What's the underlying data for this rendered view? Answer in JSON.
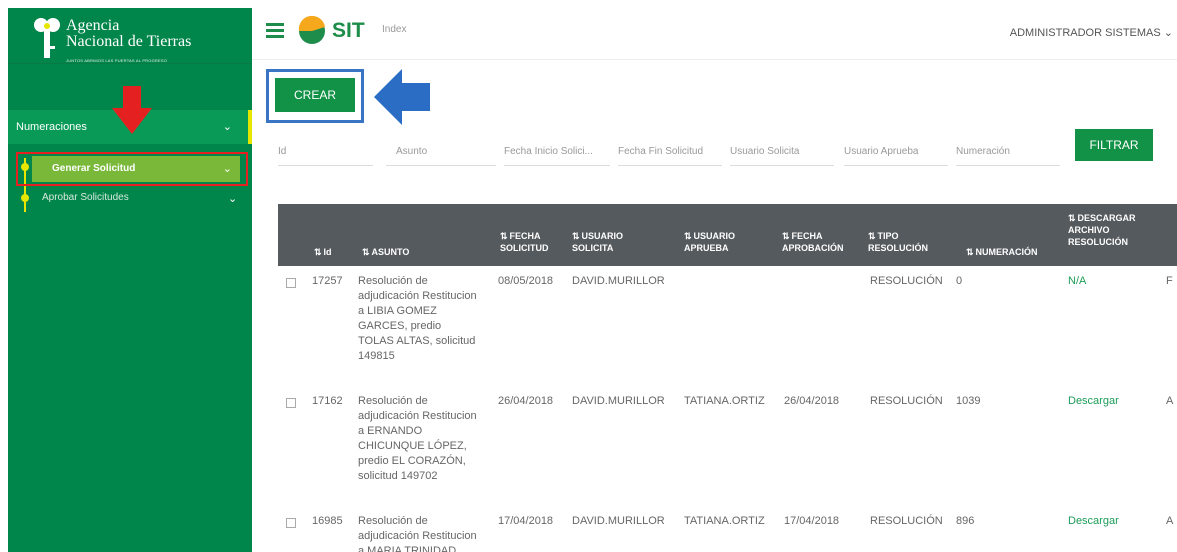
{
  "sidebar": {
    "logo_line1": "Agencia",
    "logo_line2": "Nacional de Tierras",
    "logo_sub": "JUNTOS ABRIMOS LAS PUERTAS AL PROGRESO",
    "menu": {
      "label": "Numeraciones"
    },
    "submenu_active": {
      "label": "Generar Solicitud"
    },
    "submenu_item": {
      "label": "Aprobar Solicitudes"
    }
  },
  "header": {
    "app_name": "SIT",
    "page": "Index",
    "user": "ADMINISTRADOR SISTEMAS ⌄"
  },
  "actions": {
    "create_label": "CREAR",
    "filter_label": "FILTRAR"
  },
  "filters": {
    "id": "Id",
    "asunto": "Asunto",
    "fecha_inicio": "Fecha Inicio Solici...",
    "fecha_fin": "Fecha Fin Solicitud",
    "usuario_solicita": "Usuario Solicita",
    "usuario_aprueba": "Usuario Aprueba",
    "numeracion": "Numeración"
  },
  "table": {
    "headers": {
      "id": "Id",
      "asunto": "ASUNTO",
      "fecha_solicitud_1": "FECHA",
      "fecha_solicitud_2": "SOLICITUD",
      "usuario_solicita_1": "USUARIO",
      "usuario_solicita_2": "SOLICITA",
      "usuario_aprueba_1": "USUARIO",
      "usuario_aprueba_2": "APRUEBA",
      "fecha_aprobacion_1": "FECHA",
      "fecha_aprobacion_2": "APROBACIÓN",
      "tipo_1": "TIPO",
      "tipo_2": "RESOLUCIÓN",
      "numeracion": "NUMERACIÓN",
      "descargar_1": "DESCARGAR",
      "descargar_2": "ARCHIVO",
      "descargar_3": "RESOLUCIÓN"
    },
    "rows": [
      {
        "id": "17257",
        "asunto_lines": [
          "Resolución de",
          "adjudicación Restitucion",
          "a LIBIA GOMEZ",
          "GARCES, predio",
          "TOLAS ALTAS, solicitud",
          "149815"
        ],
        "fecha_solicitud": "08/05/2018",
        "usuario_solicita": "DAVID.MURILLOR",
        "usuario_aprueba": "",
        "fecha_aprobacion": "",
        "tipo": "RESOLUCIÓN",
        "numeracion": "0",
        "descargar": "N/A",
        "extra": "F"
      },
      {
        "id": "17162",
        "asunto_lines": [
          "Resolución de",
          "adjudicación Restitucion",
          "a ERNANDO",
          "CHICUNQUE LÓPEZ,",
          "predio EL CORAZÓN,",
          "solicitud 149702"
        ],
        "fecha_solicitud": "26/04/2018",
        "usuario_solicita": "DAVID.MURILLOR",
        "usuario_aprueba": "TATIANA.ORTIZ",
        "fecha_aprobacion": "26/04/2018",
        "tipo": "RESOLUCIÓN",
        "numeracion": "1039",
        "descargar": "Descargar",
        "extra": "A"
      },
      {
        "id": "16985",
        "asunto_lines": [
          "Resolución de",
          "adjudicación Restitucion",
          "a MARIA TRINIDAD"
        ],
        "fecha_solicitud": "17/04/2018",
        "usuario_solicita": "DAVID.MURILLOR",
        "usuario_aprueba": "TATIANA.ORTIZ",
        "fecha_aprobacion": "17/04/2018",
        "tipo": "RESOLUCIÓN",
        "numeracion": "896",
        "descargar": "Descargar",
        "extra": "A"
      }
    ]
  },
  "colors": {
    "sidebar": "#00854a",
    "primary_button": "#119246",
    "table_header": "#555a5e",
    "highlight_red": "#e52020",
    "highlight_blue": "#3a74c4",
    "accent_yellow": "#e6e600",
    "active_submenu": "#7ab83a"
  }
}
